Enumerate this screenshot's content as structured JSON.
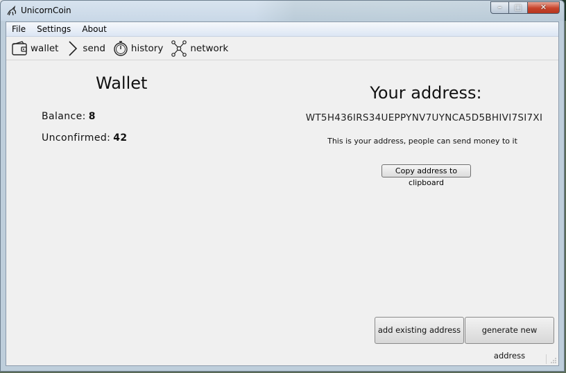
{
  "window": {
    "title": "UnicornCoin"
  },
  "menu": [
    "File",
    "Settings",
    "About"
  ],
  "toolbar": [
    {
      "label": "wallet",
      "icon": "wallet-icon"
    },
    {
      "label": "send",
      "icon": "chevron-right-icon"
    },
    {
      "label": "history",
      "icon": "stopwatch-icon"
    },
    {
      "label": "network",
      "icon": "network-icon"
    }
  ],
  "wallet": {
    "title": "Wallet",
    "balance_label": "Balance:",
    "balance_value": "8",
    "unconfirmed_label": "Unconfirmed:",
    "unconfirmed_value": "42"
  },
  "address": {
    "title": "Your address:",
    "value": "WT5H436IRS34UEPPYNV7UYNCA5D5BHIVI7SI7XI",
    "note": "This is your address, people can send money to it",
    "copy_label": "Copy address to clipboard"
  },
  "actions": {
    "add_existing": "add existing address",
    "generate_new": "generate new address"
  }
}
